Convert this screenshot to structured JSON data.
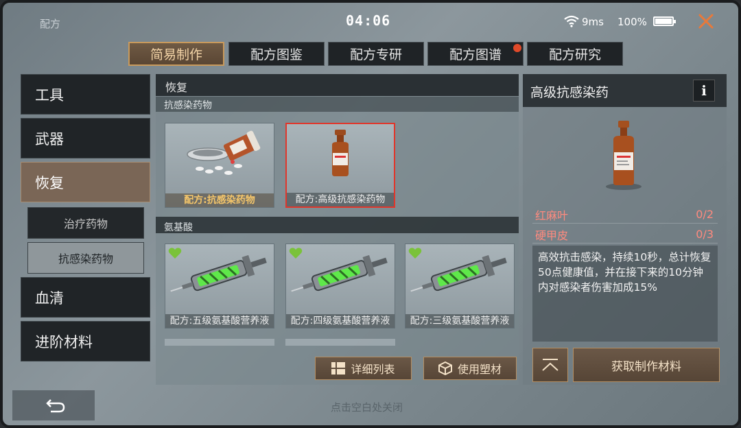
{
  "status_bar": {
    "window_title": "配方",
    "time": "04:06",
    "ping": "9ms",
    "battery": "100%",
    "battery_level": 1.0
  },
  "tabs": [
    {
      "label": "简易制作",
      "active": true
    },
    {
      "label": "配方图鉴",
      "active": false
    },
    {
      "label": "配方专研",
      "active": false
    },
    {
      "label": "配方图谱",
      "active": false,
      "notification": true
    },
    {
      "label": "配方研究",
      "active": false
    }
  ],
  "sidebar": {
    "items": [
      {
        "label": "工具"
      },
      {
        "label": "武器"
      },
      {
        "label": "恢复",
        "active": true
      },
      {
        "label": "血清"
      },
      {
        "label": "进阶材料"
      }
    ],
    "subitems": [
      {
        "label": "治疗药物"
      },
      {
        "label": "抗感染药物",
        "active": true
      }
    ]
  },
  "center": {
    "title": "恢复",
    "groups": [
      {
        "label": "抗感染药物",
        "cards": [
          {
            "label": "配方:抗感染药物",
            "icon": "pills-bowl-icon"
          },
          {
            "label": "配方:高级抗感染药物",
            "icon": "medicine-bottle-icon",
            "selected": true
          }
        ]
      },
      {
        "label": "氨基酸",
        "cards": [
          {
            "label": "配方:五级氨基酸营养液",
            "icon": "syringe-icon"
          },
          {
            "label": "配方:四级氨基酸营养液",
            "icon": "syringe-icon"
          },
          {
            "label": "配方:三级氨基酸营养液",
            "icon": "syringe-icon"
          }
        ]
      }
    ],
    "buttons": {
      "detail_list": "详细列表",
      "use_plastic": "使用塑材"
    }
  },
  "detail": {
    "name": "高级抗感染药",
    "info_label": "i",
    "materials": [
      {
        "name": "红麻叶",
        "count": "0/2"
      },
      {
        "name": "硬甲皮",
        "count": "0/3"
      }
    ],
    "description": "高效抗击感染，持续10秒，总计恢复50点健康值，并在接下来的10分钟内对感染者伤害加成15%",
    "get_materials": "获取制作材料"
  },
  "footer": {
    "hint": "点击空白处关闭"
  }
}
